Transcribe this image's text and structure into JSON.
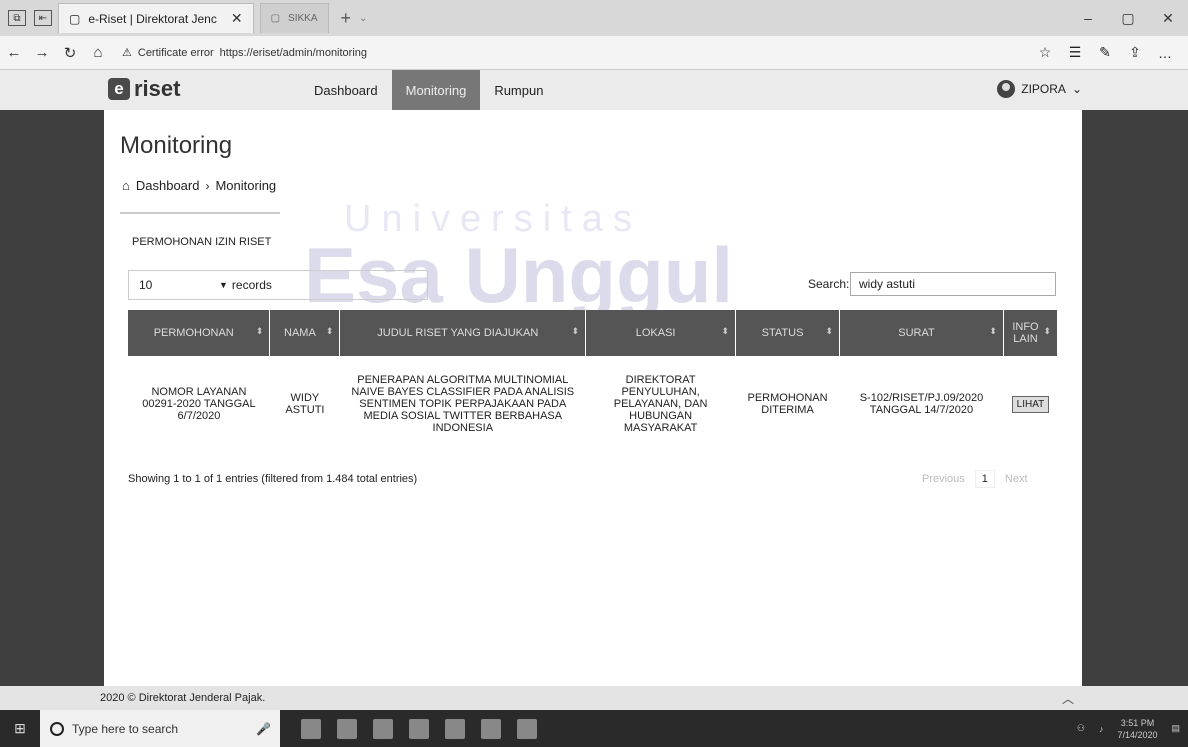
{
  "browser": {
    "tab_active_title": "e-Riset | Direktorat Jenc",
    "tab_inactive_title": "SIKKA",
    "cert_label": "Certificate error",
    "url": "https://eriset/admin/monitoring"
  },
  "site": {
    "logo_mark": "e",
    "logo_text": "riset",
    "nav": [
      "Dashboard",
      "Monitoring",
      "Rumpun"
    ],
    "user_name": "ZIPORA"
  },
  "page": {
    "title": "Monitoring",
    "breadcrumb": [
      "Dashboard",
      "Monitoring"
    ],
    "section_title": "PERMOHONAN IZIN RISET",
    "records_value": "10",
    "records_label": "records",
    "search_label": "Search:",
    "search_value": "widy astuti"
  },
  "table": {
    "headers": [
      "PERMOHONAN",
      "NAMA",
      "JUDUL RISET YANG DIAJUKAN",
      "LOKASI",
      "STATUS",
      "SURAT",
      "INFO LAIN"
    ],
    "rows": [
      {
        "permohonan": "NOMOR LAYANAN 00291-2020 TANGGAL 6/7/2020",
        "nama": "WIDY ASTUTI",
        "judul": "PENERAPAN ALGORITMA MULTINOMIAL NAIVE BAYES CLASSIFIER PADA ANALISIS SENTIMEN TOPIK PERPAJAKAAN PADA MEDIA SOSIAL TWITTER BERBAHASA INDONESIA",
        "lokasi": "DIREKTORAT PENYULUHAN, PELAYANAN, DAN HUBUNGAN MASYARAKAT",
        "status": "PERMOHONAN DITERIMA",
        "surat": "S-102/RISET/PJ.09/2020 TANGGAL 14/7/2020",
        "info_button": "LIHAT"
      }
    ]
  },
  "summary": {
    "showing": "Showing 1 to 1 of 1 entries (filtered from 1.484 total entries)",
    "previous": "Previous",
    "page": "1",
    "next": "Next"
  },
  "footer": {
    "text": "2020 © Direktorat Jenderal Pajak."
  },
  "taskbar": {
    "search_placeholder": "Type here to search",
    "time": "3:51 PM",
    "date": "7/14/2020"
  },
  "watermark": {
    "line1": "Universitas",
    "line2": "Esa Unggul",
    "line3": "Univ",
    "line4": "Es"
  }
}
